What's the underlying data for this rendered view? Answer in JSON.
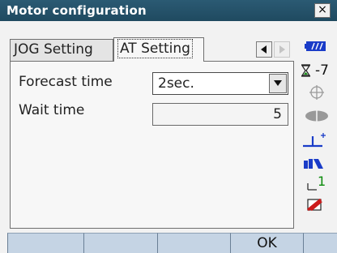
{
  "window": {
    "title": "Motor configuration",
    "close_label": "×"
  },
  "tabs": [
    {
      "label": "JOG Setting",
      "selected": false
    },
    {
      "label": "AT Setting",
      "selected": true
    }
  ],
  "tab_nav": {
    "left_icon": "triangle-left-icon",
    "right_icon": "triangle-right-icon"
  },
  "fields": {
    "forecast_time": {
      "label": "Forecast time",
      "value": "2sec."
    },
    "wait_time": {
      "label": "Wait time",
      "value": "5"
    }
  },
  "status_bar": {
    "tilt_value": "-7",
    "laser_value": "1",
    "icons": [
      "battery-icon",
      "tilt-icon",
      "crosshair-icon",
      "target-prism-icon",
      "reflector-constant-icon",
      "wireless-icon",
      "laser-pointer-icon",
      "input-mode-icon"
    ]
  },
  "softkeys": [
    "",
    "",
    "",
    "OK",
    ""
  ],
  "colors": {
    "titlebar": "#1f4a60",
    "softkey_bg": "#c5d4e4",
    "status_blue": "#1a3cc8",
    "status_green": "#0a8a0a",
    "status_red": "#cc1a1a"
  }
}
